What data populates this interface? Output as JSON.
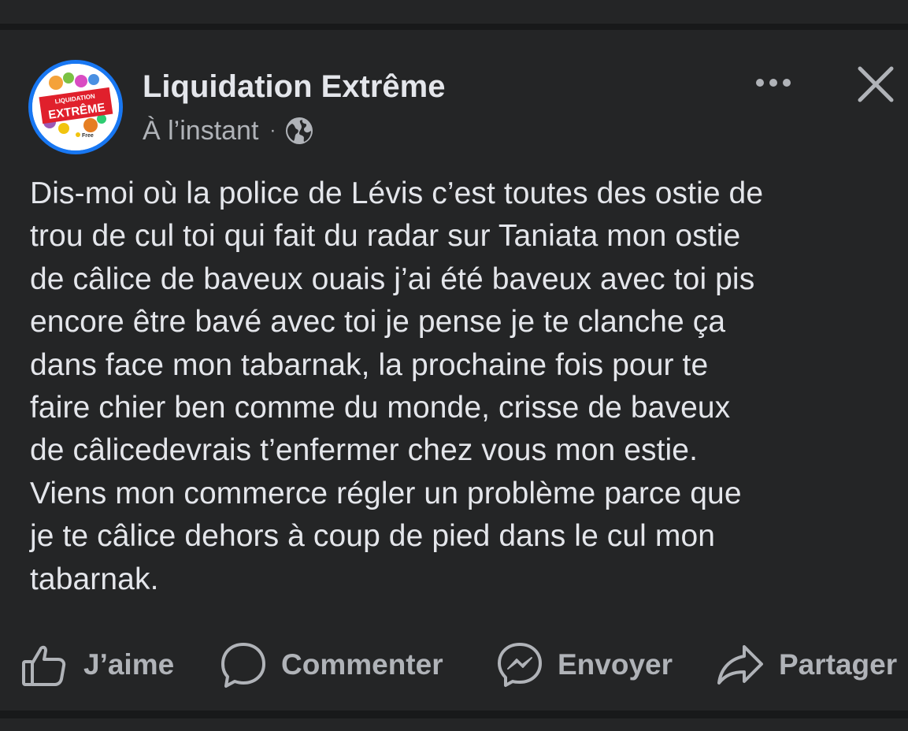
{
  "post": {
    "page_name": "Liquidation Extrême",
    "timestamp": "À l’instant",
    "separator": "·",
    "privacy_icon": "globe-icon",
    "avatar": {
      "logo_top": "LIQUIDATION",
      "logo_main": "EXTRÊME",
      "logo_small": "Free"
    },
    "body_lines": [
      "Dis-moi où la police de Lévis c’est toutes des ostie de",
      "trou de cul toi qui fait du radar sur Taniata mon ostie",
      "de câlice de baveux ouais j’ai été baveux avec toi pis",
      "encore être bavé avec toi je pense je te clanche ça",
      "dans face mon tabarnak, la prochaine fois pour te",
      "faire chier ben comme du monde, crisse de baveux",
      "de câlicedevrais t’enfermer chez vous mon estie.",
      "Viens mon commerce régler un problème parce que",
      "je te câlice dehors à coup de pied dans le cul mon",
      "tabarnak."
    ]
  },
  "actions": {
    "like": {
      "label": "J’aime",
      "icon": "thumbs-up-icon"
    },
    "comment": {
      "label": "Commenter",
      "icon": "comment-bubble-icon"
    },
    "send": {
      "label": "Envoyer",
      "icon": "messenger-icon"
    },
    "share": {
      "label": "Partager",
      "icon": "share-arrow-icon"
    }
  },
  "header_controls": {
    "more_icon": "more-dots-icon",
    "close_icon": "close-icon"
  },
  "colors": {
    "background": "#18191a",
    "card": "#242526",
    "primary_text": "#e4e6eb",
    "secondary_text": "#b0b3b8",
    "avatar_ring": "#1877f2",
    "logo_red": "#e0202c"
  }
}
